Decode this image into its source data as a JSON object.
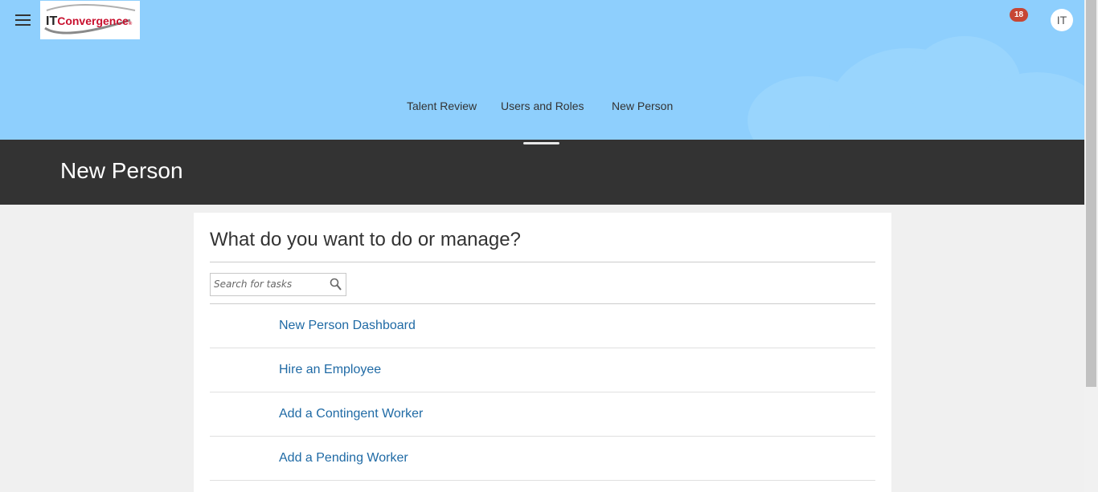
{
  "header": {
    "logo_text_it": "IT",
    "logo_text_rest": "Convergence",
    "logo_mark": "®",
    "notification_count": "18",
    "user_initials": "IT"
  },
  "nav": {
    "items": [
      {
        "label": "Talent Review"
      },
      {
        "label": "Users and Roles"
      },
      {
        "label": "New Person"
      }
    ]
  },
  "page": {
    "title": "New Person"
  },
  "panel": {
    "heading": "What do you want to do or manage?",
    "search_placeholder": "Search for tasks",
    "tasks": [
      {
        "label": "New Person Dashboard"
      },
      {
        "label": "Hire an Employee"
      },
      {
        "label": "Add a Contingent Worker"
      },
      {
        "label": "Add a Pending Worker"
      }
    ]
  },
  "icons": {
    "menu": "hamburger-icon",
    "search": "magnifier-icon"
  },
  "colors": {
    "header_bg": "#8ecffd",
    "title_bar_bg": "#333333",
    "link": "#1f6aa5",
    "badge": "#c74634"
  }
}
